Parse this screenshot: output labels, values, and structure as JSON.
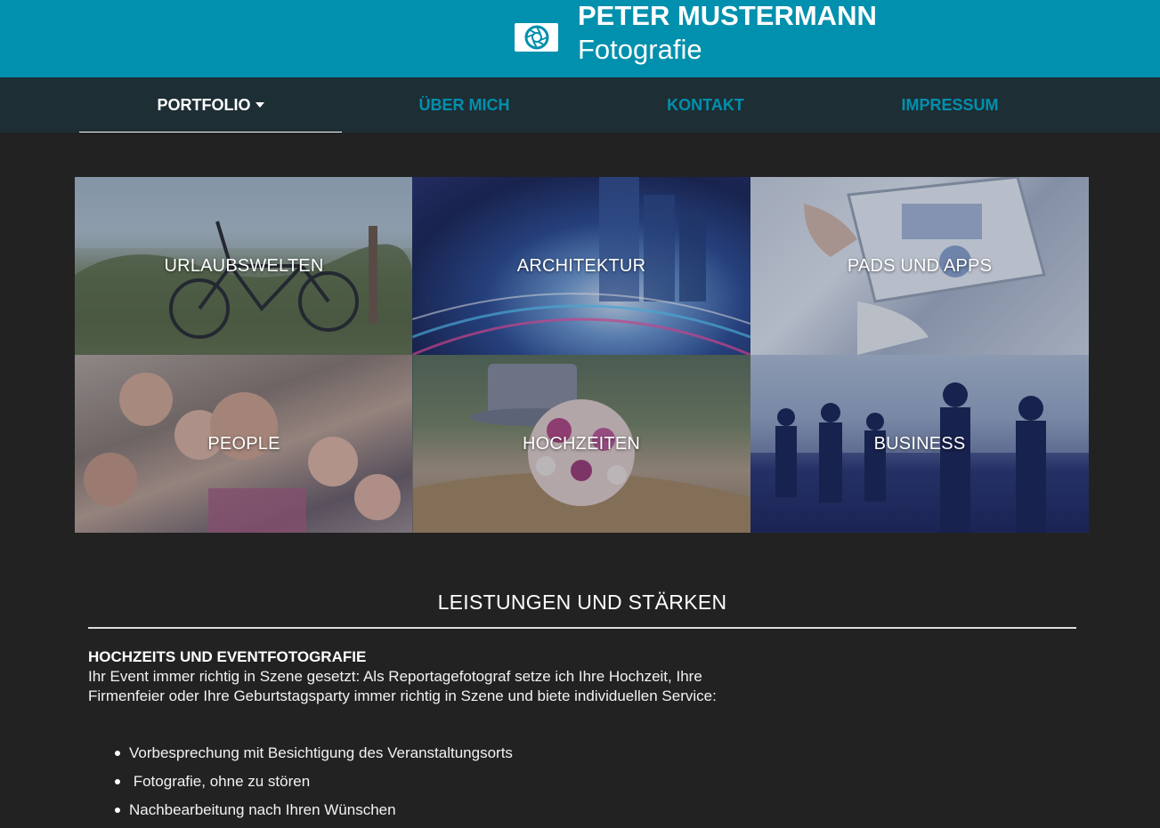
{
  "brand": {
    "name": "PETER MUSTERMANN",
    "subtitle": "Fotografie",
    "logo_icon": "camera-aperture-icon",
    "header_color": "#0190ad",
    "nav_color": "#1d2e35"
  },
  "nav": {
    "items": [
      {
        "label": "PORTFOLIO",
        "active": true,
        "has_dropdown": true
      },
      {
        "label": "ÜBER MICH",
        "active": false
      },
      {
        "label": "KONTAKT",
        "active": false
      },
      {
        "label": "IMPRESSUM",
        "active": false
      }
    ]
  },
  "portfolio": {
    "tiles": [
      {
        "label": "URLAUBSWELTEN"
      },
      {
        "label": "ARCHITEKTUR"
      },
      {
        "label": "PADS UND APPS"
      },
      {
        "label": "PEOPLE"
      },
      {
        "label": "HOCHZEITEN"
      },
      {
        "label": "BUSINESS"
      }
    ]
  },
  "services": {
    "title": "LEISTUNGEN UND STÄRKEN",
    "sub_heading": "HOCHZEITS UND EVENTFOTOGRAFIE",
    "paragraph": "Ihr Event immer richtig in Szene gesetzt: Als Reportagefotograf setze ich Ihre Hochzeit, Ihre Firmenfeier oder Ihre Geburtstagsparty immer richtig in Szene und biete individuellen Service:",
    "list": [
      "Vorbesprechung mit Besichtigung des Veranstaltungsorts",
      " Fotografie, ohne zu stören",
      "Nachbearbeitung nach Ihren Wünschen"
    ]
  }
}
